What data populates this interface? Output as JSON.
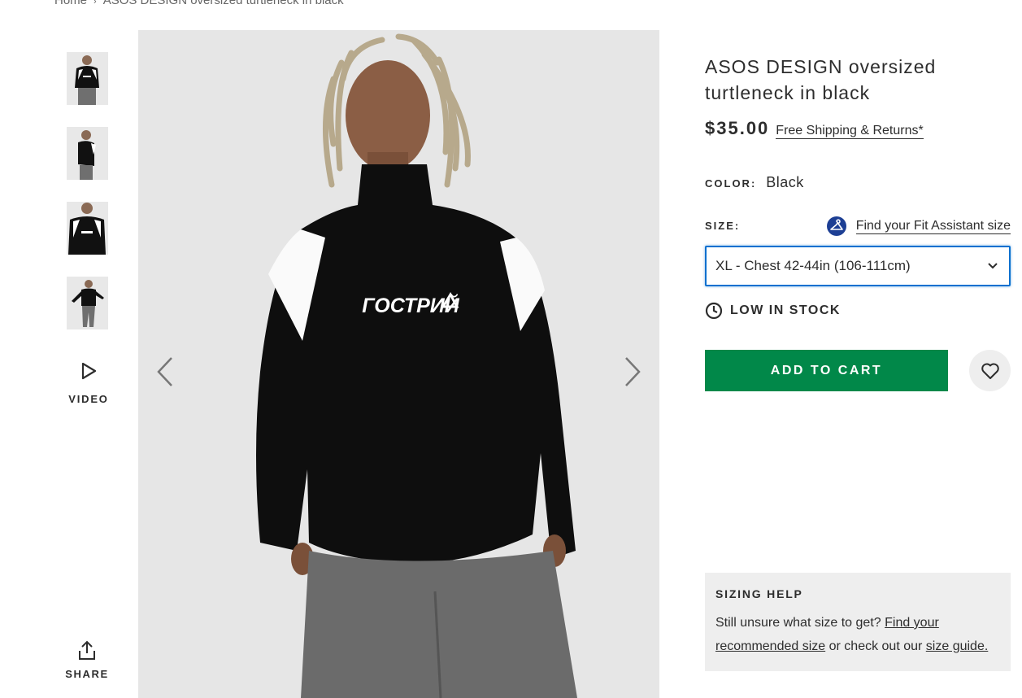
{
  "breadcrumb": {
    "home": "Home",
    "separator": "›",
    "current": "ASOS DESIGN oversized turtleneck in black"
  },
  "thumbnails": [
    {
      "icon": "product-thumbnail-front"
    },
    {
      "icon": "product-thumbnail-side"
    },
    {
      "icon": "product-thumbnail-closeup"
    },
    {
      "icon": "product-thumbnail-full"
    }
  ],
  "video": {
    "label": "VIDEO",
    "icon": "play-icon"
  },
  "share": {
    "label": "SHARE",
    "icon": "share-icon"
  },
  "gallery": {
    "graphic_text": "ГОСТРИЙ",
    "prev_icon": "chevron-left-icon",
    "next_icon": "chevron-right-icon"
  },
  "product": {
    "title": "ASOS DESIGN oversized turtleneck in black",
    "price": "$35.00",
    "shipping_link": "Free Shipping & Returns*",
    "color_label": "COLOR:",
    "color_value": "Black",
    "size_label": "SIZE:",
    "fit_assistant_link": "Find your Fit Assistant size",
    "size_selected": "XL - Chest 42-44in (106-111cm)",
    "stock_status": "LOW IN STOCK",
    "add_to_cart": "ADD TO CART"
  },
  "sizing_help": {
    "title": "SIZING HELP",
    "text_1": "Still unsure what size to get? ",
    "link_1": "Find your recommended size",
    "text_2": " or check out our ",
    "link_2": "size guide."
  },
  "colors": {
    "accent_green": "#018849",
    "focus_blue": "#0770cf",
    "fit_icon_blue": "#1d3f94",
    "panel_gray": "#eeeeee"
  }
}
